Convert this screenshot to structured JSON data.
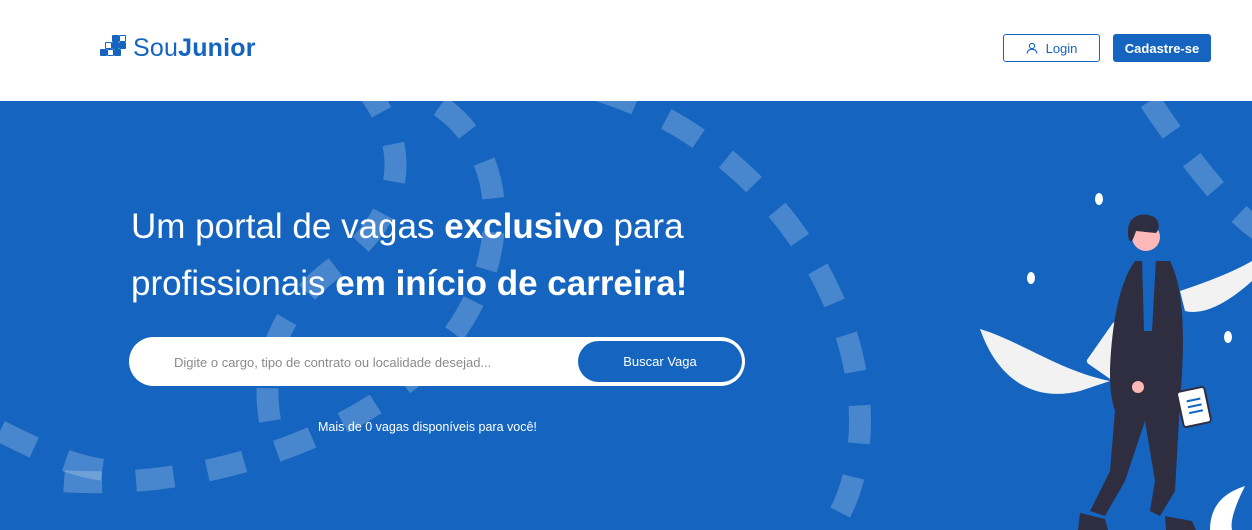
{
  "header": {
    "logo_prefix": "Sou",
    "logo_suffix": "Junior",
    "login_label": "Login",
    "signup_label": "Cadastre-se"
  },
  "hero": {
    "headline_part1": "Um portal de vagas ",
    "headline_bold1": "exclusivo",
    "headline_part2": " para profissionais ",
    "headline_bold2": "em início de carreira!",
    "search_placeholder": "Digite o cargo, tipo de contrato ou localidade desejad...",
    "search_button": "Buscar Vaga",
    "count_text": "Mais de 0 vagas disponíveis para você!"
  },
  "icons": {
    "logo": "squares-logo-icon",
    "login": "user-icon"
  },
  "colors": {
    "brand": "#1565c0",
    "white": "#ffffff"
  }
}
